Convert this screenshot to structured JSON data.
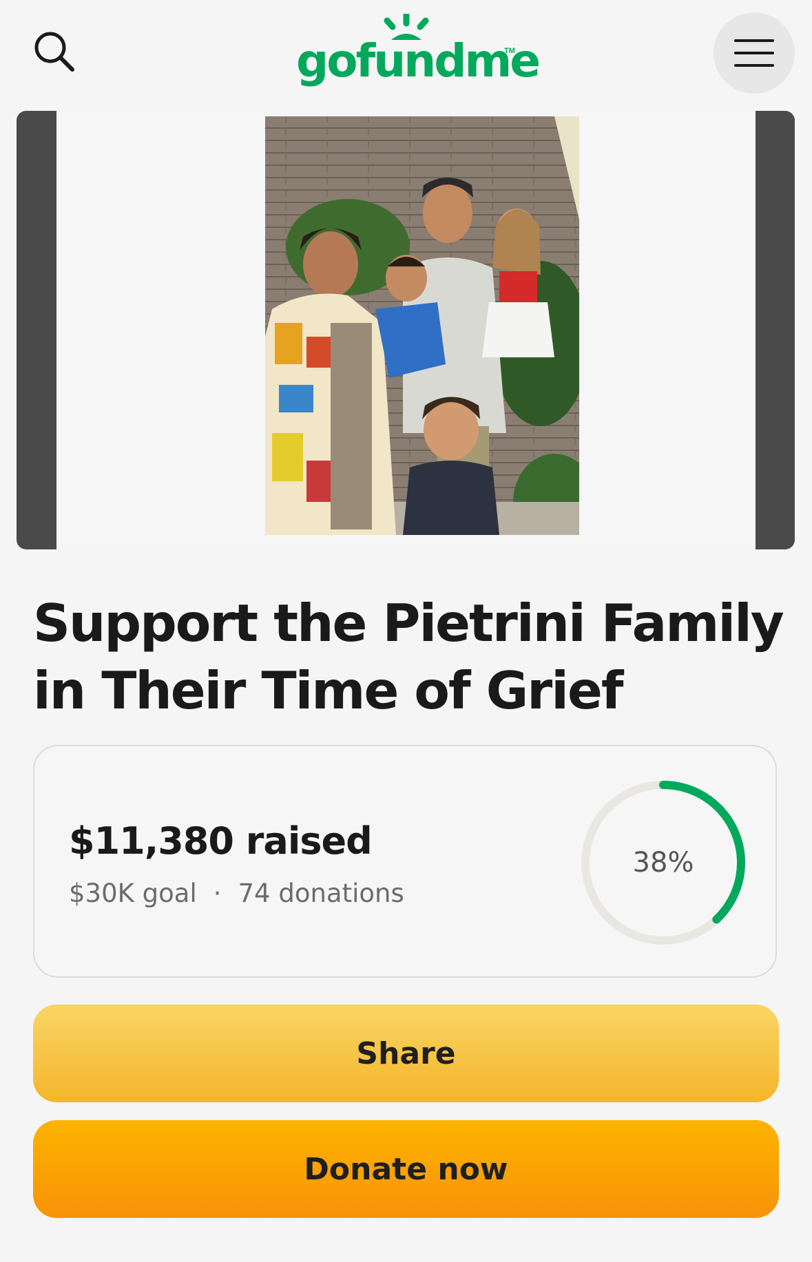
{
  "header": {
    "logo_text": "gofundme",
    "logo_tm": "TM",
    "brand_color": "#02a95c",
    "search_icon": "search-icon",
    "menu_icon": "hamburger-menu-icon"
  },
  "campaign": {
    "title": "Support the Pietrini Family in Their Time of Grief",
    "raised": "$11,380 raised",
    "goal": "$30K goal",
    "separator": "·",
    "donations": "74 donations",
    "progress_percent_label": "38%",
    "progress_fraction": 0.38
  },
  "actions": {
    "share_label": "Share",
    "donate_label": "Donate now"
  },
  "colors": {
    "progress_ring": "#02a95c",
    "ring_track": "#e8e7e2",
    "share_button": "#f6c444",
    "donate_button": "#fba40a"
  }
}
